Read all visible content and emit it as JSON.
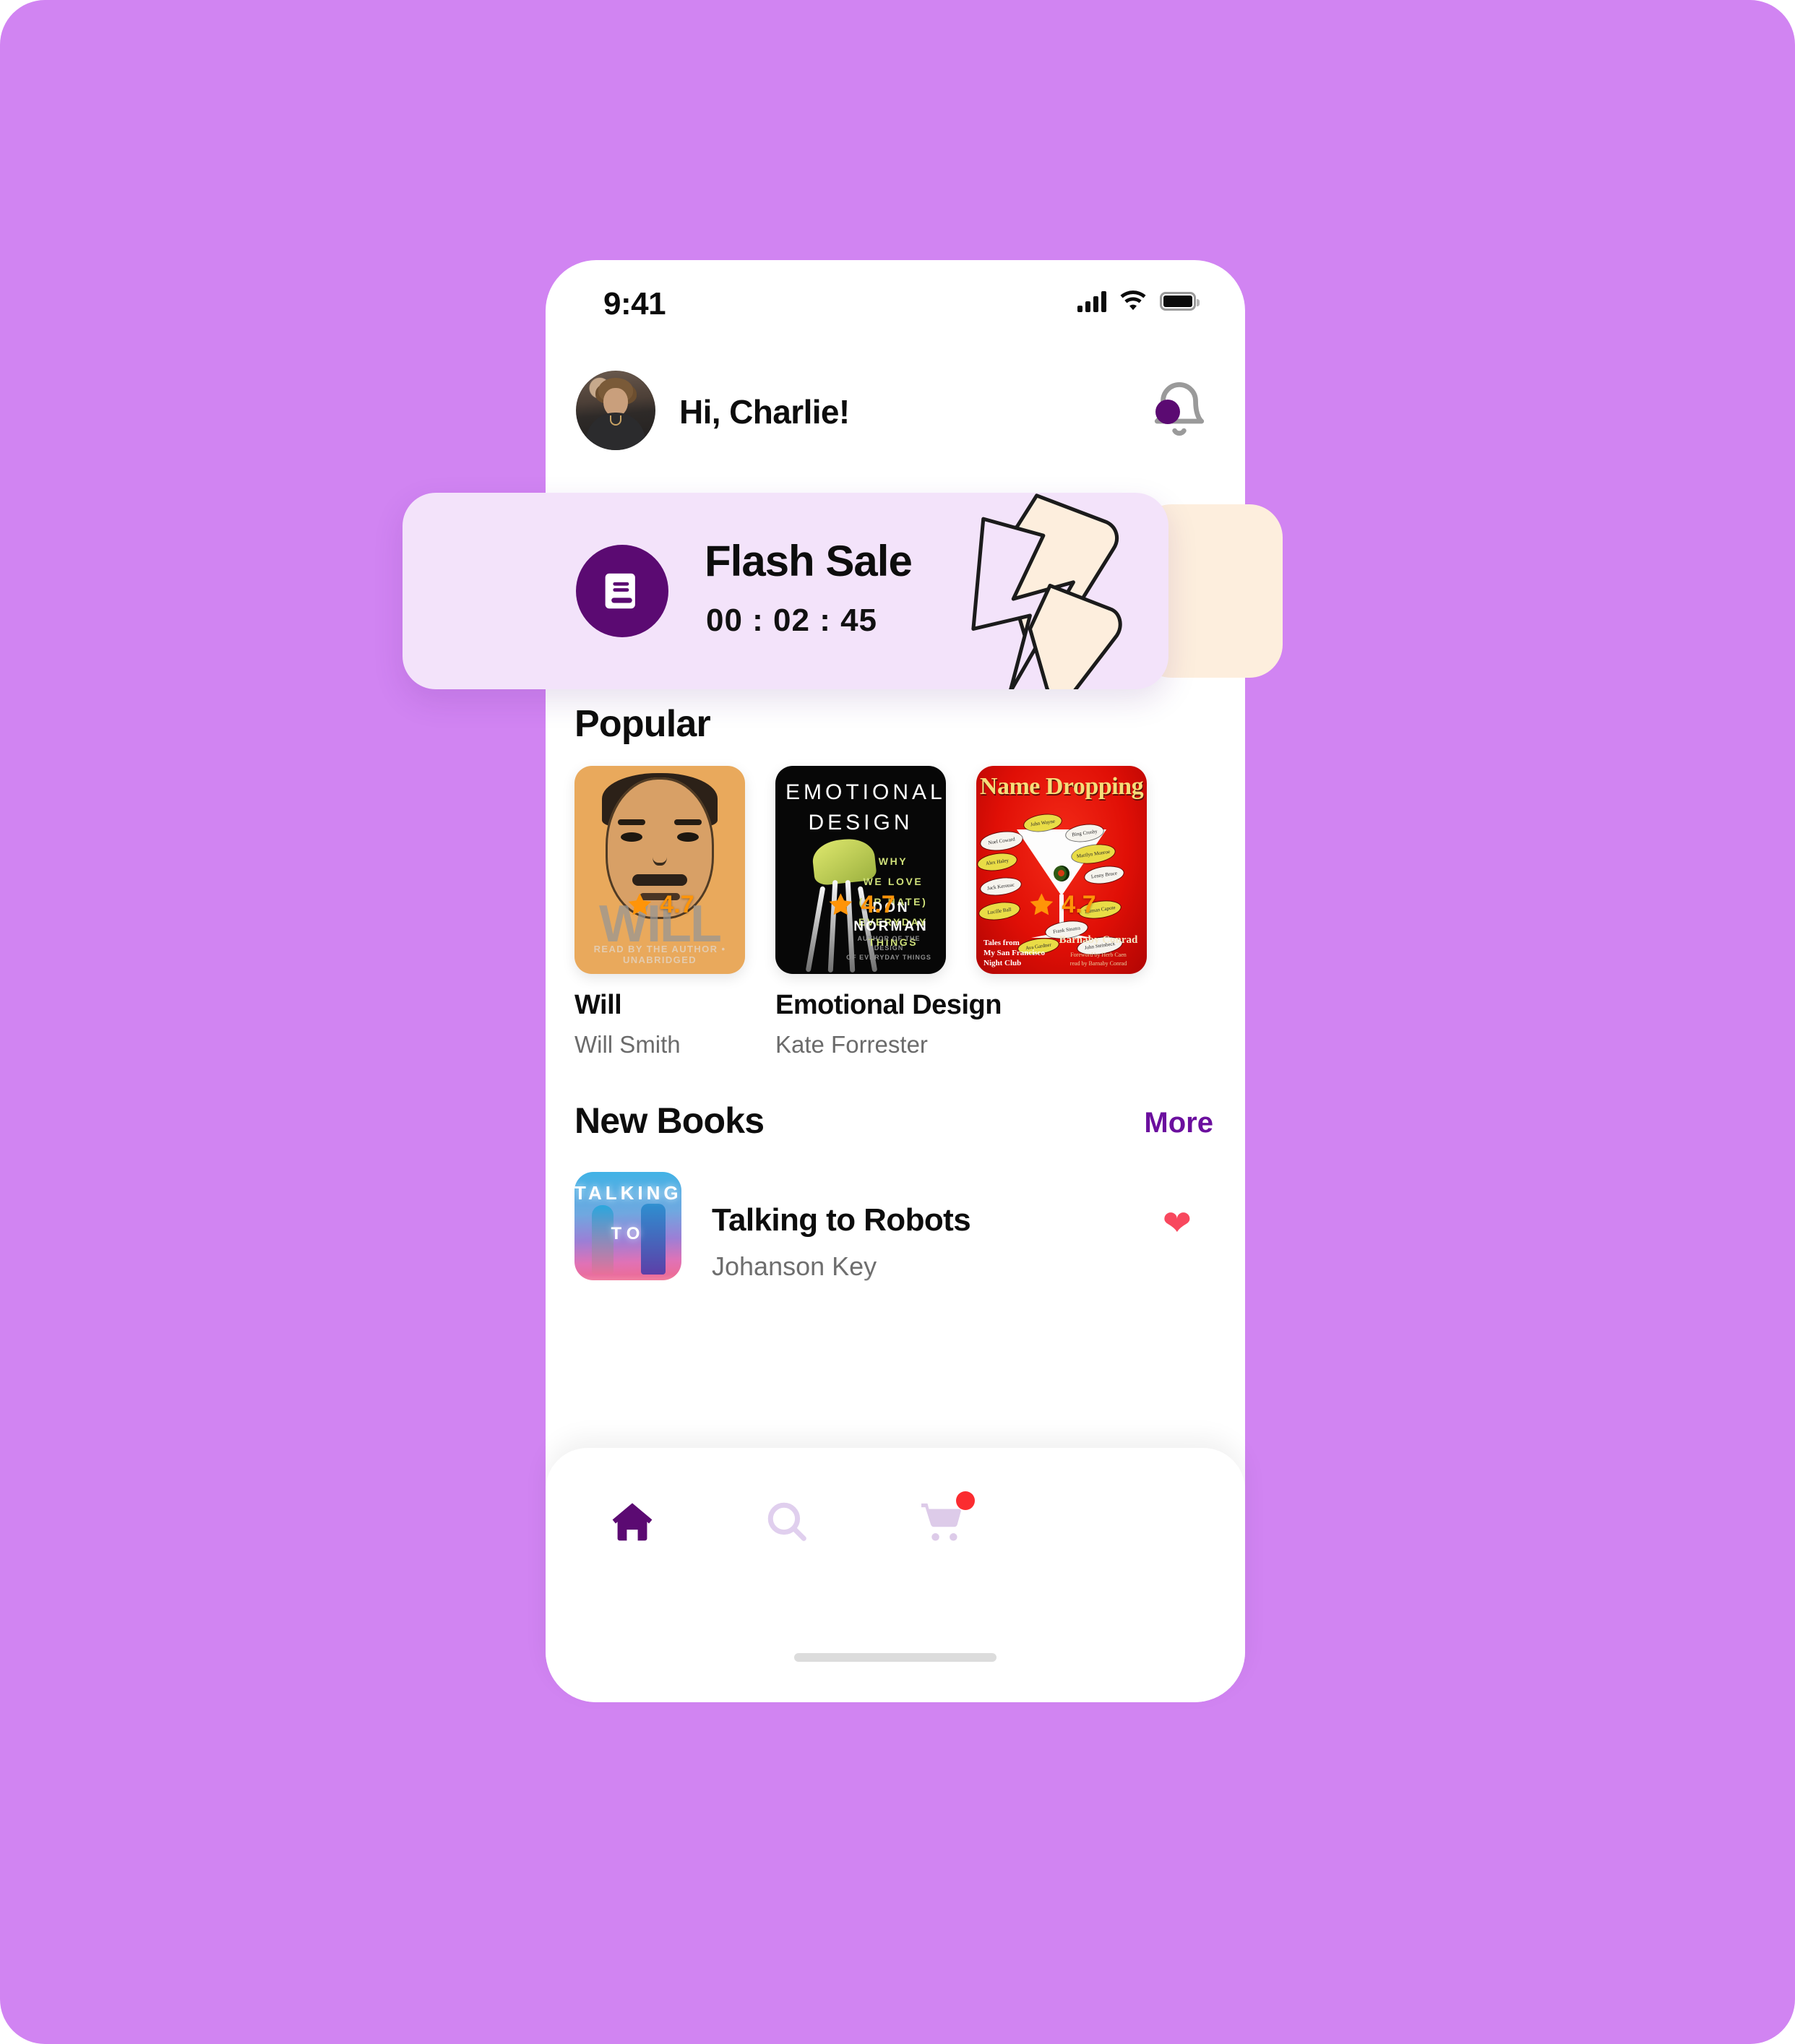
{
  "theme": {
    "backdrop": "#d184f2",
    "accent_purple": "#5b0a72",
    "link_purple": "#6b0f9e",
    "rating_orange": "#ff9408",
    "heart_red": "#f8485e",
    "badge_red": "#fb2c30",
    "flash_card_bg": "#f3e3fa",
    "peek_card_bg": "#fdeedd"
  },
  "status_bar": {
    "time": "9:41",
    "signal_icon": "cellular-bars-icon",
    "wifi_icon": "wifi-icon",
    "battery_icon": "battery-full-icon"
  },
  "header": {
    "avatar_icon": "user-avatar",
    "greeting": "Hi, Charlie!",
    "bell_icon": "notification-bell-icon",
    "has_notification": true
  },
  "flash_sale": {
    "icon": "book-icon",
    "title": "Flash Sale",
    "timer": "00 : 02 : 45",
    "decoration_icon": "lightning-bolt-icon"
  },
  "popular": {
    "heading": "Popular",
    "books": [
      {
        "title": "Will",
        "author": "Will Smith",
        "rating": "4.7",
        "cover_icon": "book-cover-will",
        "cover_word": "WILL",
        "cover_sub": "READ BY THE AUTHOR • UNABRIDGED"
      },
      {
        "title": "Emotional Design",
        "author": "Kate Forrester",
        "rating": "4.7",
        "cover_icon": "book-cover-emotional-design",
        "cover_line1": "EMOTIONAL",
        "cover_line2": "DESIGN",
        "cover_tagline": "WHY\nWE LOVE\n(OR HATE)\nEVERYDAY\nTHINGS",
        "cover_author": "DON\nNORMAN",
        "cover_footer": "AUTHOR OF THE DESIGN\nOF EVERYDAY THINGS"
      },
      {
        "title": "",
        "author": "",
        "rating": "4.7",
        "cover_icon": "book-cover-name-dropping",
        "cover_title": "Name Dropping",
        "cover_footer": "Tales from\nMy San Francisco\nNight Club",
        "cover_author": "Barnaby Conrad",
        "cover_credits": "Foreword by Herb Caen\nread by Barnaby Conrad",
        "bubbles": [
          "John Wayne",
          "Bing Crosby",
          "Noel Coward",
          "Marilyn Monroe",
          "Alex Haley",
          "Lenny Bruce",
          "Jack Kerouac",
          "Truman Capote",
          "Lucille Ball",
          "Frank Sinatra",
          "Ava Gardner",
          "John Steinbeck"
        ]
      }
    ]
  },
  "new_books": {
    "heading": "New Books",
    "more_label": "More",
    "items": [
      {
        "title": "Talking to Robots",
        "author": "Johanson Key",
        "cover_icon": "book-cover-talking-to-robots",
        "cover_line1": "TALKING",
        "cover_line2": "TO",
        "favorite_icon": "heart-filled-icon",
        "favorited": true
      }
    ]
  },
  "bottom_nav": {
    "items": [
      {
        "icon": "home-icon",
        "active": true
      },
      {
        "icon": "search-icon",
        "active": false
      },
      {
        "icon": "cart-icon",
        "active": false,
        "badge": true
      }
    ],
    "home_indicator": "home-indicator-bar"
  }
}
